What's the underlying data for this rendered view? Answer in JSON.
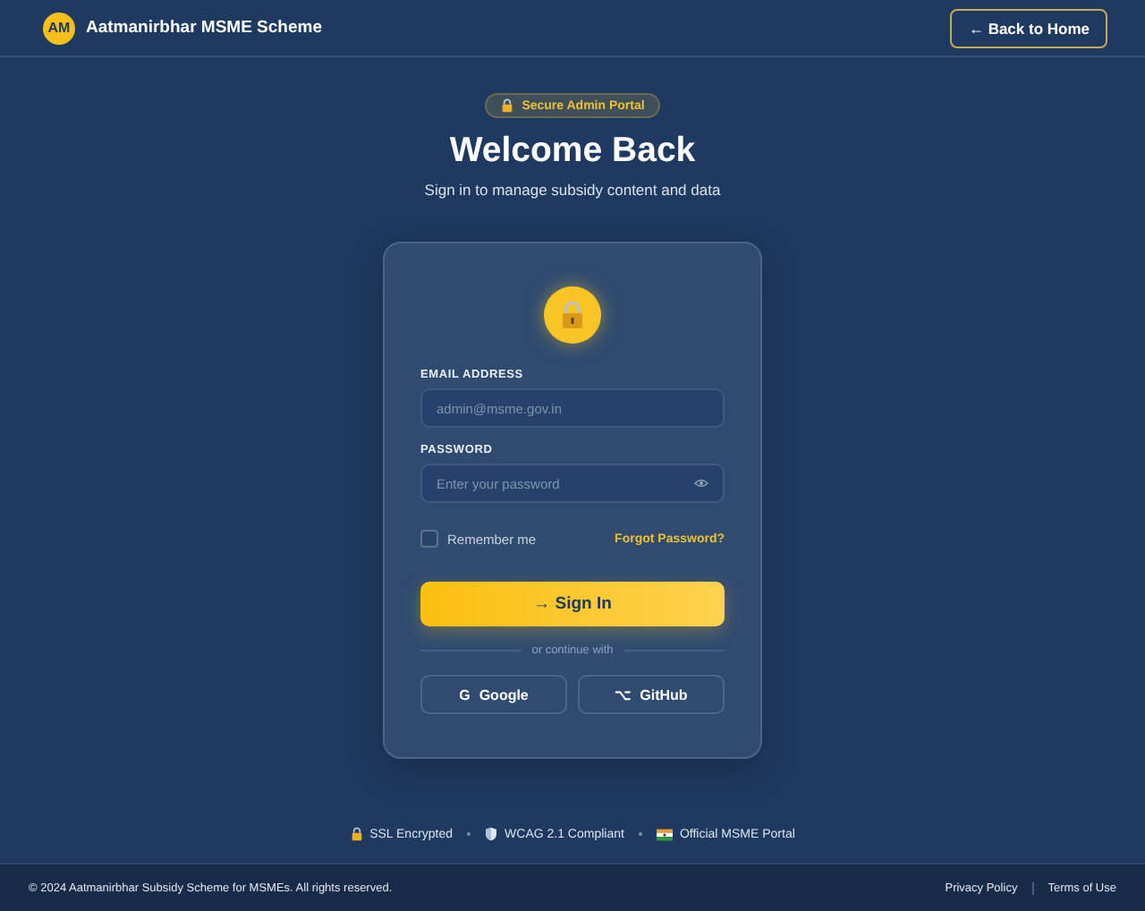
{
  "header": {
    "logo": "AM",
    "title": "Aatmanirbhar MSME Scheme",
    "back_button": "← Back to Home"
  },
  "badge": "Secure Admin Portal",
  "title": "Welcome Back",
  "subtitle": "Sign in to manage subsidy content and data",
  "form": {
    "email": {
      "label": "EMAIL ADDRESS",
      "placeholder": "admin@msme.gov.in"
    },
    "password": {
      "label": "PASSWORD",
      "placeholder": "Enter your password"
    },
    "remember": {
      "label": "Remember me",
      "checked": false
    },
    "forgot": "Forgot Password?",
    "submit": "→ Sign In",
    "divider": "or continue with",
    "social": [
      {
        "icon": "G",
        "label": "Google"
      },
      {
        "icon": "⌥",
        "label": "GitHub"
      }
    ]
  },
  "trust": [
    {
      "kind": "lock",
      "label": "SSL Encrypted"
    },
    {
      "kind": "shield",
      "label": "WCAG 2.1 Compliant"
    },
    {
      "kind": "flag",
      "label": "Official MSME Portal"
    }
  ],
  "footer": {
    "copyright": "© 2024 Aatmanirbhar Subsidy Scheme for MSMEs. All rights reserved.",
    "links": [
      "Privacy Policy",
      "Terms of Use"
    ]
  }
}
